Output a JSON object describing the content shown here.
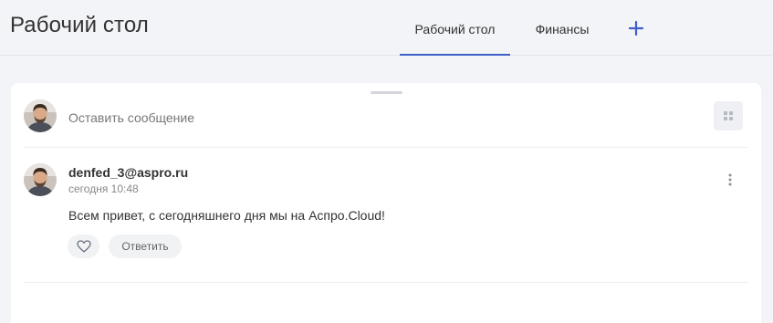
{
  "header": {
    "title": "Рабочий стол",
    "tabs": [
      {
        "label": "Рабочий стол",
        "active": true
      },
      {
        "label": "Финансы",
        "active": false
      }
    ],
    "add_icon": "plus-icon"
  },
  "composer": {
    "placeholder": "Оставить сообщение",
    "avatar_icon": "user-avatar",
    "widgets_icon": "grid-icon"
  },
  "post": {
    "author": "denfed_3@aspro.ru",
    "time": "сегодня 10:48",
    "text": "Всем привет, с сегодняшнего дня мы на Аспро.Cloud!",
    "like_icon": "heart-icon",
    "reply_label": "Ответить",
    "menu_icon": "more-vertical-icon"
  },
  "colors": {
    "accent": "#3e5fc6",
    "background": "#f3f4f7",
    "card": "#ffffff",
    "button_bg": "#f1f2f4"
  }
}
